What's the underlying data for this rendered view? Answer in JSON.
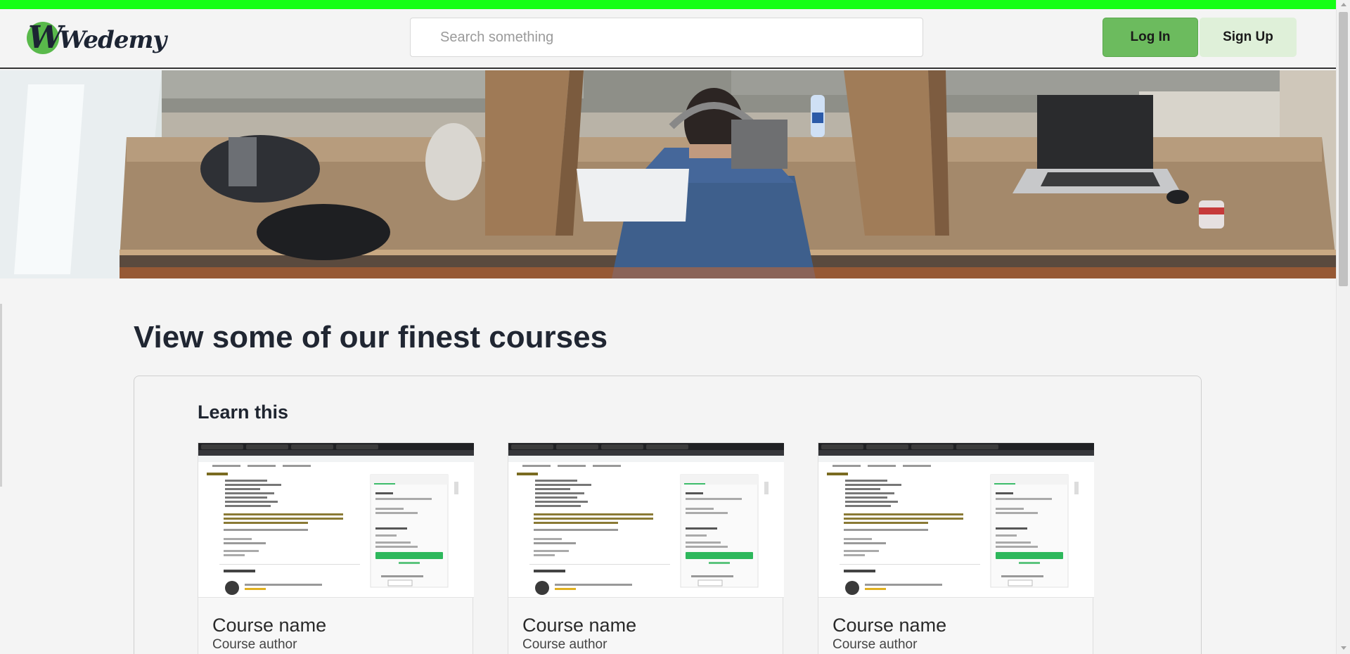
{
  "brand": {
    "logo_letter": "W",
    "name": "Wedemy"
  },
  "search": {
    "placeholder": "Search something"
  },
  "auth": {
    "login_label": "Log In",
    "signup_label": "Sign Up"
  },
  "hero": {
    "image": "workspace-photo"
  },
  "courses_section": {
    "title": "View some of our finest courses",
    "panel_title": "Learn this",
    "courses": [
      {
        "name": "Course name",
        "author": "Course author"
      },
      {
        "name": "Course name",
        "author": "Course author"
      },
      {
        "name": "Course name",
        "author": "Course author"
      }
    ]
  },
  "colors": {
    "accent_green": "#6cbb5e",
    "top_strip": "#14ff14",
    "signup_bg": "#dff0d9",
    "text_dark": "#202632"
  }
}
